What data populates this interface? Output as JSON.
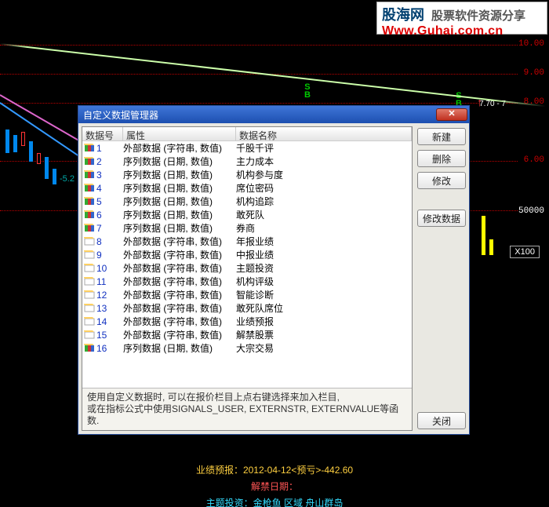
{
  "watermark": {
    "han": "股海网",
    "desc": "股票软件资源分享",
    "url": "Www.Guhai.com.cn"
  },
  "axis": {
    "y1": "10.00",
    "y2": "9.00",
    "y3": "8.00",
    "y4": "6.00",
    "y5": "50000",
    "x100": "X100",
    "price_tag": "7.70 - 7"
  },
  "markers": {
    "s": "S",
    "b": "B",
    "neg5": "-5.2"
  },
  "dialog": {
    "title": "自定义数据管理器",
    "close_x": "✕",
    "columns": {
      "num": "数据号",
      "attr": "属性",
      "name": "数据名称"
    },
    "rows": [
      {
        "n": "1",
        "icon": "multi",
        "attr": "外部数据 (字符串, 数值)",
        "name": "千股千评"
      },
      {
        "n": "2",
        "icon": "multi",
        "attr": "序列数据 (日期, 数值)",
        "name": "主力成本"
      },
      {
        "n": "3",
        "icon": "multi",
        "attr": "序列数据 (日期, 数值)",
        "name": "机构参与度"
      },
      {
        "n": "4",
        "icon": "multi",
        "attr": "序列数据 (日期, 数值)",
        "name": "席位密码"
      },
      {
        "n": "5",
        "icon": "multi",
        "attr": "序列数据 (日期, 数值)",
        "name": "机构追踪"
      },
      {
        "n": "6",
        "icon": "multi",
        "attr": "序列数据 (日期, 数值)",
        "name": "敢死队"
      },
      {
        "n": "7",
        "icon": "multi",
        "attr": "序列数据 (日期, 数值)",
        "name": "券商"
      },
      {
        "n": "8",
        "icon": "plain",
        "attr": "外部数据 (字符串, 数值)",
        "name": "年报业绩"
      },
      {
        "n": "9",
        "icon": "plain",
        "attr": "外部数据 (字符串, 数值)",
        "name": "中报业绩"
      },
      {
        "n": "10",
        "icon": "plain",
        "attr": "外部数据 (字符串, 数值)",
        "name": "主题投资"
      },
      {
        "n": "11",
        "icon": "plain",
        "attr": "外部数据 (字符串, 数值)",
        "name": "机构评级"
      },
      {
        "n": "12",
        "icon": "plain",
        "attr": "外部数据 (字符串, 数值)",
        "name": "智能诊断"
      },
      {
        "n": "13",
        "icon": "plain",
        "attr": "外部数据 (字符串, 数值)",
        "name": "敢死队席位"
      },
      {
        "n": "14",
        "icon": "plain",
        "attr": "外部数据 (字符串, 数值)",
        "name": "业绩预报"
      },
      {
        "n": "15",
        "icon": "plain",
        "attr": "外部数据 (字符串, 数值)",
        "name": "解禁股票"
      },
      {
        "n": "16",
        "icon": "multi",
        "attr": "序列数据 (日期, 数值)",
        "name": "大宗交易"
      }
    ],
    "hint_l1": "使用自定义数据时, 可以在报价栏目上点右键选择来加入栏目,",
    "hint_l2": "或在指标公式中使用SIGNALS_USER, EXTERNSTR, EXTERNVALUE等函数.",
    "buttons": {
      "new": "新建",
      "del": "删除",
      "edit": "修改",
      "edit_data": "修改数据",
      "close": "关闭"
    }
  },
  "bottom": {
    "l1_a": "业绩预报：",
    "l1_b": "2012-04-12<预亏>-442.60",
    "l2": "解禁日期：",
    "l3_a": "主题投资：",
    "l3_b": "金枪鱼 区域 舟山群岛"
  }
}
